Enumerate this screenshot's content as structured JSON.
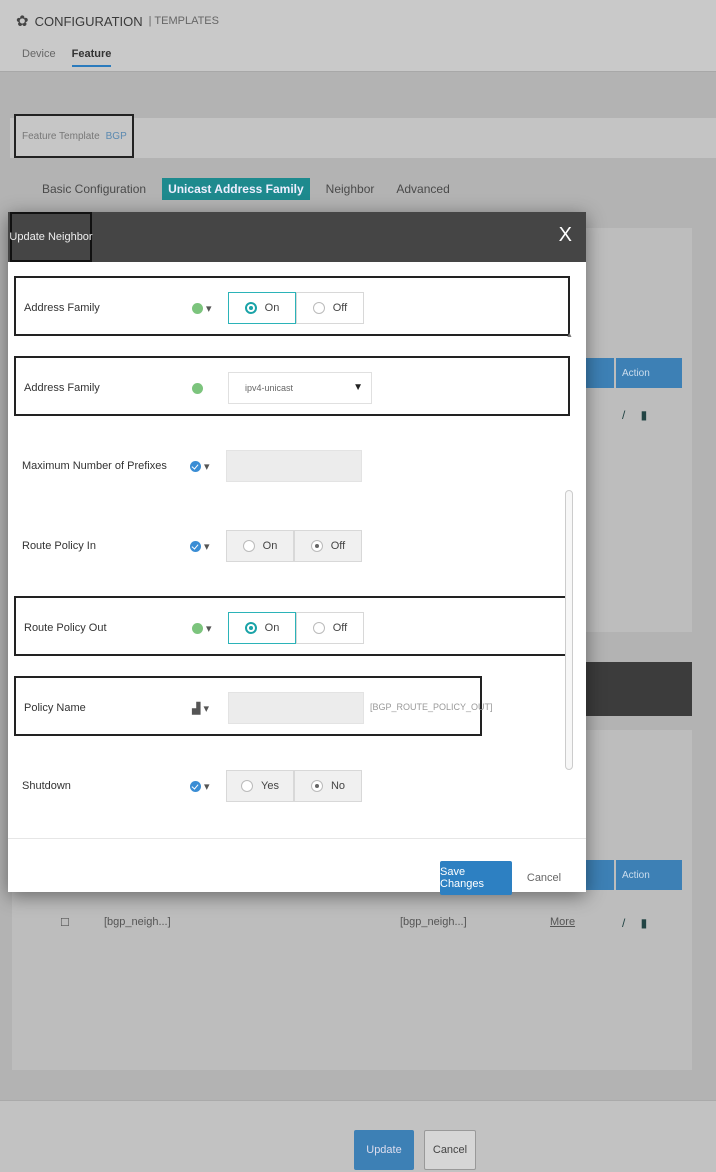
{
  "header": {
    "title": "CONFIGURATION",
    "subtitle": "TEMPLATES",
    "tabs": [
      "Device",
      "Feature"
    ]
  },
  "breadcrumb": {
    "label": "Feature Template",
    "current": "BGP"
  },
  "feature_tabs": [
    "Basic Configuration",
    "Unicast Address Family",
    "Neighbor",
    "Advanced"
  ],
  "background": {
    "action_header": "Action",
    "row_neighbor": "[bgp_neigh...]",
    "row_neighbor2": "[bgp_neigh...]",
    "row_more": "More"
  },
  "modal": {
    "title": "Update Neighbor",
    "close": "X",
    "rows": [
      {
        "label": "Address Family",
        "type": "toggle",
        "on": "On",
        "off": "Off",
        "selected": "on",
        "scope": "default"
      },
      {
        "label": "Address Family",
        "type": "select",
        "value": "ipv4-unicast",
        "scope": "default"
      },
      {
        "label": "Maximum Number of Prefixes",
        "type": "text",
        "scope": "global"
      },
      {
        "label": "Route Policy In",
        "type": "toggle",
        "on": "On",
        "off": "Off",
        "selected": "off",
        "scope": "global"
      },
      {
        "label": "Route Policy Out",
        "type": "toggle",
        "on": "On",
        "off": "Off",
        "selected": "on",
        "scope": "default"
      },
      {
        "label": "Policy Name",
        "type": "variable",
        "variable": "[BGP_ROUTE_POLICY_OUT]",
        "scope": "device"
      },
      {
        "label": "Shutdown",
        "type": "toggle",
        "on": "Yes",
        "off": "No",
        "selected": "off",
        "scope": "global"
      }
    ],
    "save_label": "Save Changes",
    "cancel_label": "Cancel"
  },
  "footer": {
    "update_label": "Update",
    "cancel_label": "Cancel"
  },
  "colors": {
    "accent": "#2d80c2",
    "teal": "#1aa3a8",
    "header": "#454545"
  }
}
